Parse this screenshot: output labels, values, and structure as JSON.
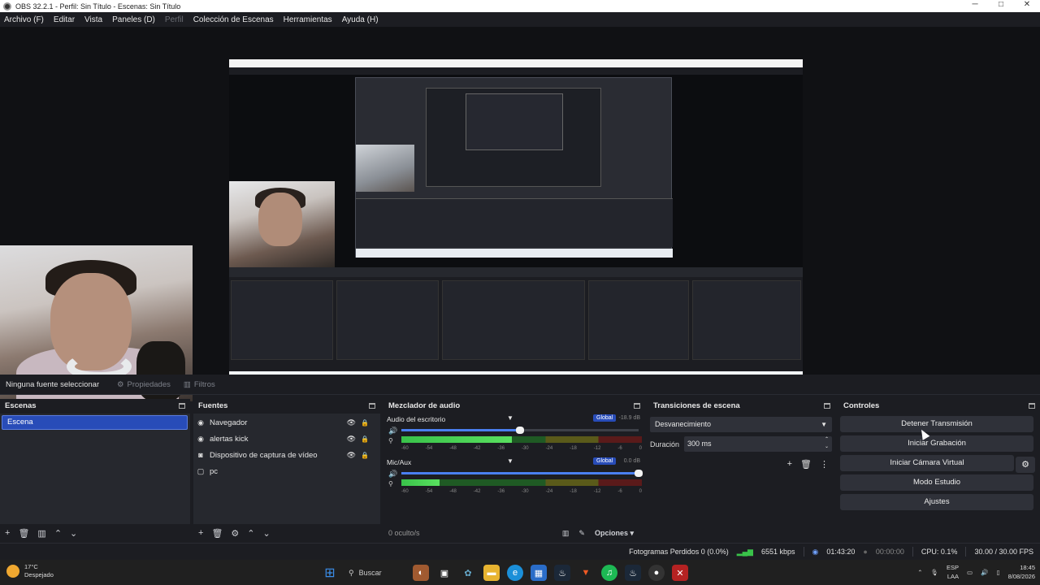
{
  "window": {
    "title": "OBS 32.2.1 - Perfil: Sin Título - Escenas: Sin Título",
    "controls": [
      "─",
      "□",
      "✕"
    ]
  },
  "menu": [
    "Archivo (F)",
    "Editar",
    "Vista",
    "Paneles (D)",
    "Perfil",
    "Colección de Escenas",
    "Herramientas",
    "Ayuda (H)"
  ],
  "source_bar": {
    "no_source": "Ninguna fuente seleccionar",
    "properties": "Propiedades",
    "filters": "Filtros"
  },
  "scenes": {
    "title": "Escenas",
    "items": [
      "Escena"
    ]
  },
  "sources": {
    "title": "Fuentes",
    "items": [
      {
        "name": "Navegador",
        "icon": "browser-icon"
      },
      {
        "name": "alertas kick",
        "icon": "browser-icon"
      },
      {
        "name": "Dispositivo de captura de vídeo",
        "icon": "camera-icon"
      },
      {
        "name": "pc",
        "icon": "display-icon"
      }
    ]
  },
  "mixer": {
    "title": "Mezclador de audio",
    "channels": [
      {
        "name": "Audio del escritorio",
        "badge": "Global",
        "db": "-18.9 dB",
        "volume": 0.5,
        "level": 0.46
      },
      {
        "name": "Mic/Aux",
        "badge": "Global",
        "db": "0.0 dB",
        "volume": 1.0,
        "level": 0.16
      }
    ],
    "ticks": [
      "-60",
      "-54",
      "-48",
      "-42",
      "-36",
      "-30",
      "-24",
      "-18",
      "-12",
      "-6",
      "0"
    ],
    "hidden": "0 oculto/s",
    "options": "Opciones"
  },
  "transitions": {
    "title": "Transiciones de escena",
    "selected": "Desvanecimiento",
    "duration_label": "Duración",
    "duration": "300 ms"
  },
  "controls": {
    "title": "Controles",
    "stop_stream": "Detener Transmisión",
    "start_rec": "Iniciar Grabación",
    "virtual_cam": "Iniciar Cámara Virtual",
    "studio": "Modo Estudio",
    "settings": "Ajustes"
  },
  "status": {
    "dropped": "Fotogramas Perdidos 0 (0.0%)",
    "bitrate": "6551 kbps",
    "live_time": "01:43:20",
    "rec_time": "00:00:00",
    "cpu": "CPU: 0.1%",
    "fps": "30.00 / 30.00 FPS"
  },
  "taskbar": {
    "temp": "17°C",
    "weather": "Despejado",
    "search": "Buscar",
    "lang1": "ESP",
    "lang2": "LAA",
    "time": "18:45",
    "date": "8/08/2026"
  },
  "colors": {
    "accent": "#284cb8",
    "meter_green": "#39c24a",
    "panel": "#26282e",
    "bg": "#1c1d22"
  }
}
